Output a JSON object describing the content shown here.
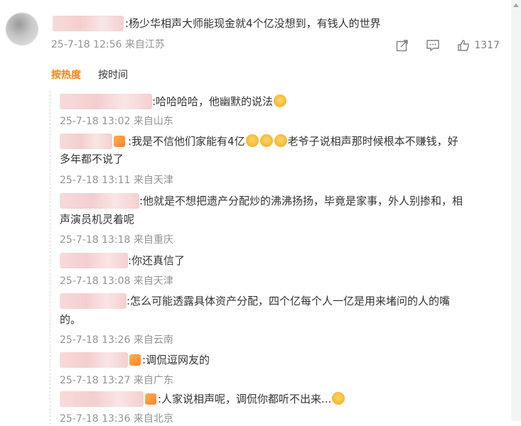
{
  "post": {
    "text": ":杨少华相声大师能现金就4个亿没想到，有钱人的世界",
    "meta": "25-7-18 12:56 来自江苏",
    "like_count": "1317"
  },
  "tabs": {
    "hot": "按热度",
    "time": "按时间"
  },
  "replies": [
    {
      "text": ":哈哈哈哈，他幽默的说法",
      "meta": "25-7-18 13:02 来自山东"
    },
    {
      "text_a": ":我是不信他们家能有4亿",
      "text_b": "老爷子说相声那时候根本不赚钱，好",
      "text_c": "多年都不说了",
      "meta": "25-7-18 13:11 来自天津"
    },
    {
      "text_a": ":他就是不想把遗产分配炒的沸沸扬扬，毕竟是家事，外人别掺和，相",
      "text_b": "声演员机灵着呢",
      "meta": "25-7-18 13:18 来自重庆"
    },
    {
      "text": ":你还真信了",
      "meta": "25-7-18 13:08 来自天津"
    },
    {
      "text_a": ":怎么可能透露具体资产分配，四个亿每个人一亿是用来堵问的人的嘴",
      "text_b": "的。",
      "meta": "25-7-18 13:26 来自云南"
    },
    {
      "text": ":调侃逗网友的",
      "meta": "25-7-18 13:27 来自广东"
    },
    {
      "text": ":人家说相声呢，调侃你都听不出来...",
      "meta": "25-7-18 13:36 来自北京"
    }
  ],
  "icons": {
    "share": "share-icon",
    "comment": "comment-icon",
    "like": "thumbs-up-icon"
  },
  "colors": {
    "accent": "#ff8200",
    "meta": "#939393"
  }
}
